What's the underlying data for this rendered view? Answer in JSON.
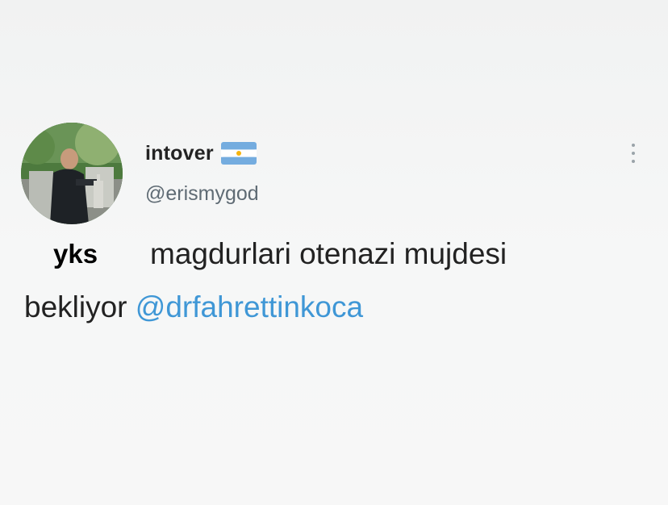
{
  "tweet": {
    "display_name": "intover",
    "handle": "@erismygod",
    "flag_icon": "argentina-flag-icon",
    "more_icon": "more-vertical-icon",
    "overlay_label": "yks",
    "text_line1": "magdurlari otenazi mujdesi",
    "text_line2_prefix": "bekliyor",
    "mention": "@drfahrettinkoca"
  },
  "colors": {
    "background": "#f4f5f5",
    "text": "#222222",
    "handle": "#5f6b74",
    "mention": "#3f97d6",
    "flag_blue": "#74acdf",
    "flag_sun": "#f6b40e"
  }
}
